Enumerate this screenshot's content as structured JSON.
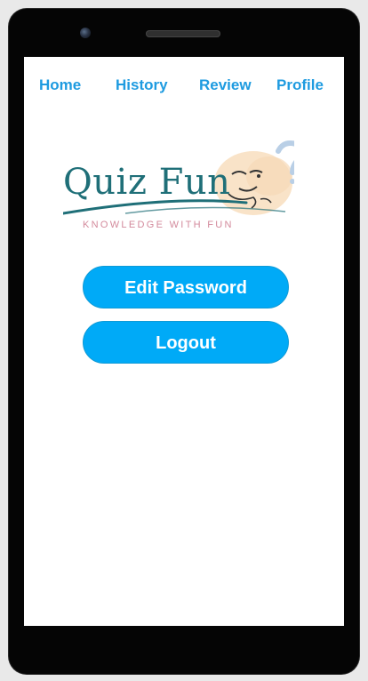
{
  "nav": {
    "items": [
      {
        "label": "Home"
      },
      {
        "label": "History"
      },
      {
        "label": "Review"
      },
      {
        "label": "Profile"
      }
    ]
  },
  "logo": {
    "title": "Quiz Fun",
    "tagline": "KNOWLEDGE WITH FUN"
  },
  "actions": {
    "edit_password_label": "Edit Password",
    "logout_label": "Logout"
  },
  "colors": {
    "accent": "#00aaf7",
    "nav_text": "#1e9be0",
    "logo_text": "#1f6f78",
    "tagline": "#d38a9c"
  }
}
